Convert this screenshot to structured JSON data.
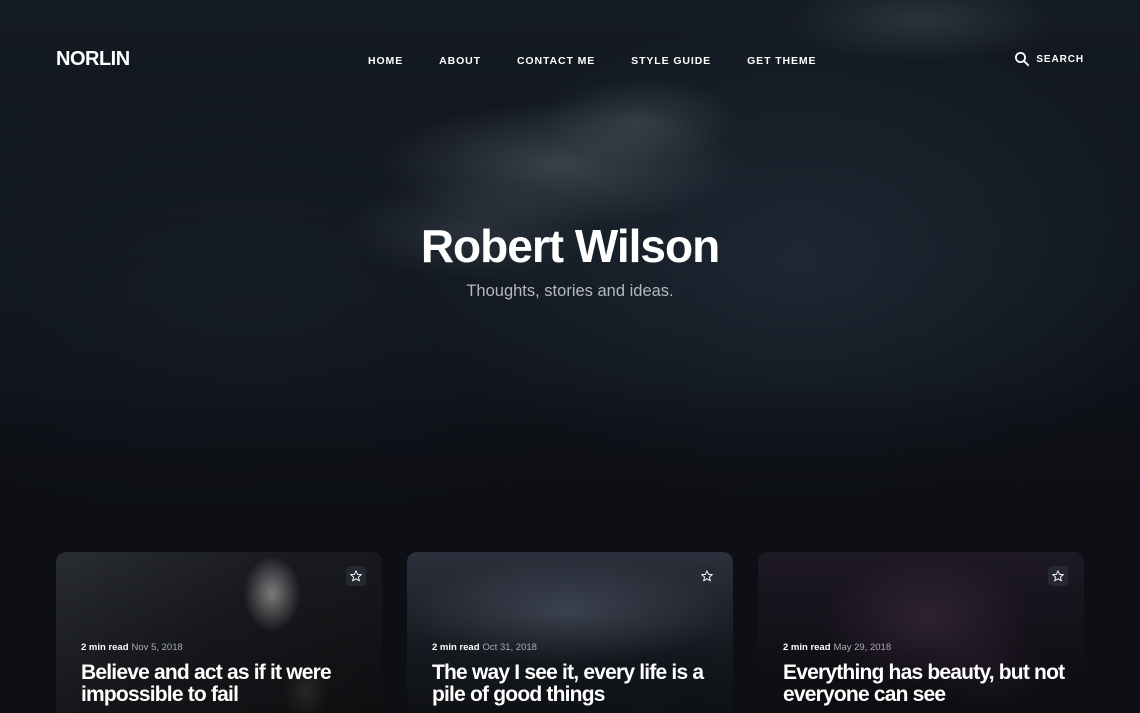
{
  "header": {
    "logo": "NORLIN",
    "nav": [
      "HOME",
      "ABOUT",
      "CONTACT ME",
      "STYLE GUIDE",
      "GET THEME"
    ],
    "search_label": "SEARCH"
  },
  "hero": {
    "title": "Robert Wilson",
    "subtitle": "Thoughts, stories and ideas."
  },
  "posts": [
    {
      "read_time": "2 min read",
      "date": "Nov 5, 2018",
      "title": "Believe and act as if it were impossible to fail"
    },
    {
      "read_time": "2 min read",
      "date": "Oct 31, 2018",
      "title": "The way I see it, every life is a pile of good things"
    },
    {
      "read_time": "2 min read",
      "date": "May 29, 2018",
      "title": "Everything has beauty, but not everyone can see"
    }
  ],
  "icons": {
    "search": "search-icon",
    "favorite": "star-outline-icon"
  },
  "colors": {
    "background": "#0d0f14",
    "text": "#ffffff",
    "muted_text": "#b4b8bf"
  }
}
